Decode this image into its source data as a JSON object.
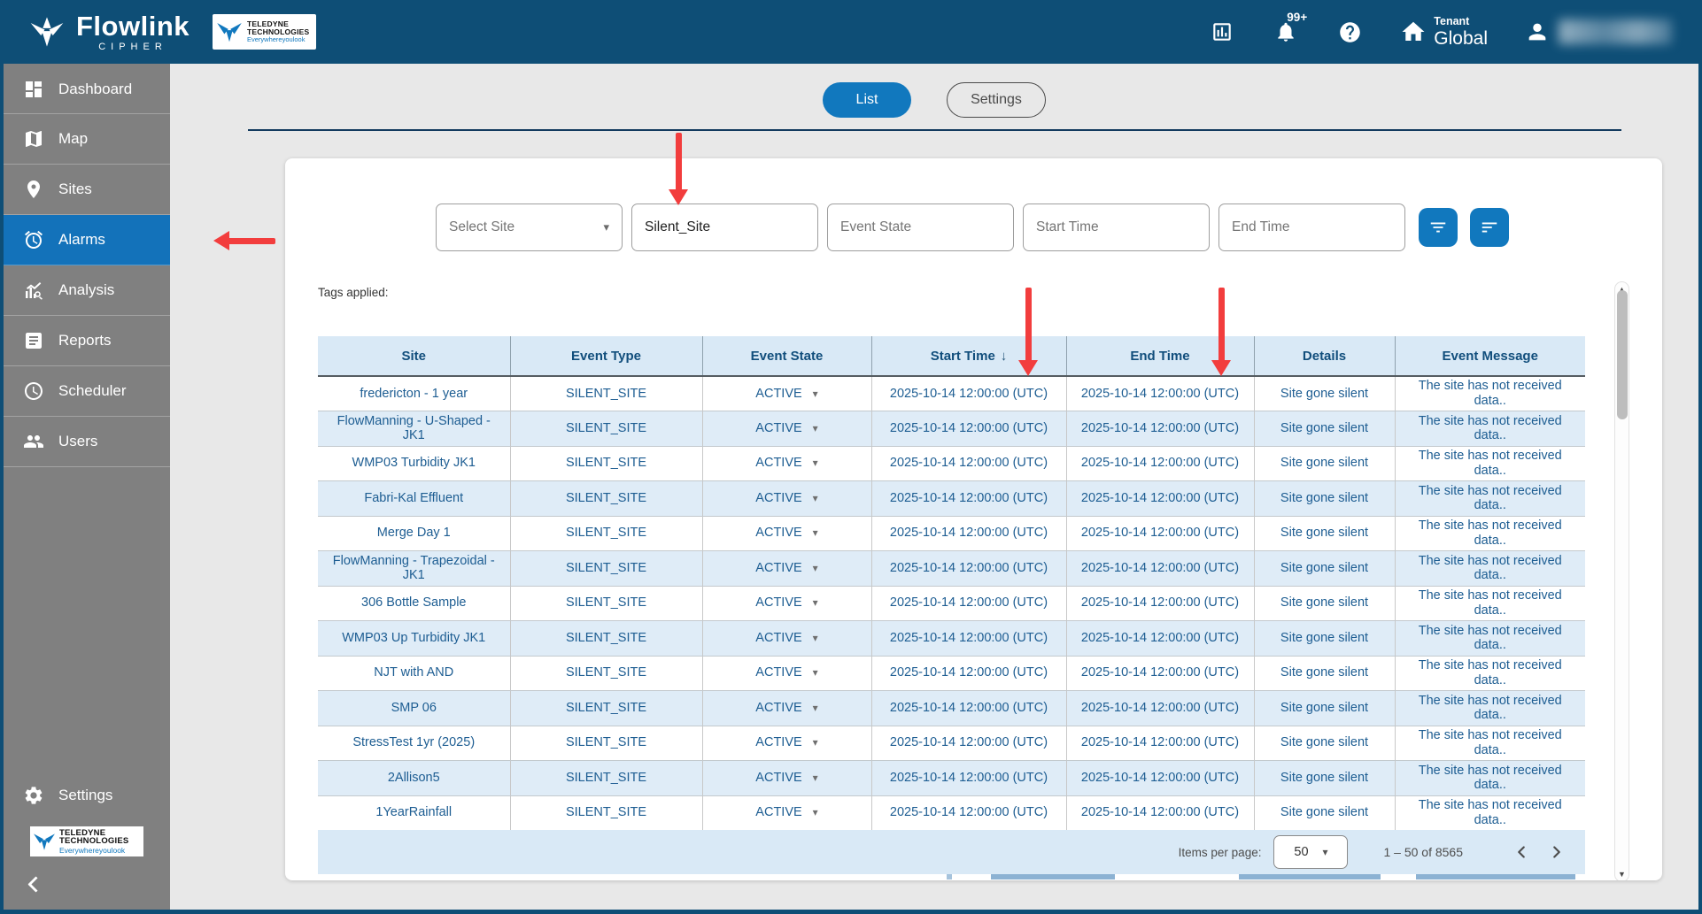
{
  "navbar": {
    "brand_name": "Flowlink",
    "brand_sub": "CIPHER",
    "teledyne": {
      "line1": "TELEDYNE",
      "line2": "TECHNOLOGIES",
      "tagline": "Everywhereyoulook"
    },
    "notification_badge": "99+",
    "tenant_label": "Tenant",
    "tenant_name": "Global"
  },
  "sidebar": {
    "items": [
      {
        "label": "Dashboard",
        "icon": "dashboard-icon",
        "active": false
      },
      {
        "label": "Map",
        "icon": "map-icon",
        "active": false
      },
      {
        "label": "Sites",
        "icon": "location-pin-icon",
        "active": false
      },
      {
        "label": "Alarms",
        "icon": "alarm-clock-icon",
        "active": true
      },
      {
        "label": "Analysis",
        "icon": "analysis-chart-icon",
        "active": false
      },
      {
        "label": "Reports",
        "icon": "report-document-icon",
        "active": false
      },
      {
        "label": "Scheduler",
        "icon": "clock-icon",
        "active": false
      },
      {
        "label": "Users",
        "icon": "people-icon",
        "active": false
      }
    ],
    "settings_label": "Settings",
    "teledyne": {
      "line1": "TELEDYNE",
      "line2": "TECHNOLOGIES",
      "tagline": "Everywhereyoulook"
    }
  },
  "view_toggle": {
    "list_label": "List",
    "settings_label": "Settings"
  },
  "filters": {
    "select_site_placeholder": "Select Site",
    "site_value": "Silent_Site",
    "event_state_placeholder": "Event State",
    "start_time_placeholder": "Start Time",
    "end_time_placeholder": "End Time"
  },
  "tags_applied_label": "Tags applied:",
  "table": {
    "columns": [
      "Site",
      "Event Type",
      "Event State",
      "Start Time",
      "End Time",
      "Details",
      "Event Message"
    ],
    "sort_column": "Start Time",
    "sort_indicator": "↓",
    "rows": [
      {
        "site": "fredericton - 1 year",
        "event_type": "SILENT_SITE",
        "event_state": "ACTIVE",
        "start_time": "2025-10-14 12:00:00 (UTC)",
        "end_time": "2025-10-14 12:00:00 (UTC)",
        "details": "Site gone silent",
        "message": "The site has not received data.."
      },
      {
        "site": "FlowManning - U-Shaped - JK1",
        "event_type": "SILENT_SITE",
        "event_state": "ACTIVE",
        "start_time": "2025-10-14 12:00:00 (UTC)",
        "end_time": "2025-10-14 12:00:00 (UTC)",
        "details": "Site gone silent",
        "message": "The site has not received data.."
      },
      {
        "site": "WMP03 Turbidity JK1",
        "event_type": "SILENT_SITE",
        "event_state": "ACTIVE",
        "start_time": "2025-10-14 12:00:00 (UTC)",
        "end_time": "2025-10-14 12:00:00 (UTC)",
        "details": "Site gone silent",
        "message": "The site has not received data.."
      },
      {
        "site": "Fabri-Kal Effluent",
        "event_type": "SILENT_SITE",
        "event_state": "ACTIVE",
        "start_time": "2025-10-14 12:00:00 (UTC)",
        "end_time": "2025-10-14 12:00:00 (UTC)",
        "details": "Site gone silent",
        "message": "The site has not received data.."
      },
      {
        "site": "Merge Day 1",
        "event_type": "SILENT_SITE",
        "event_state": "ACTIVE",
        "start_time": "2025-10-14 12:00:00 (UTC)",
        "end_time": "2025-10-14 12:00:00 (UTC)",
        "details": "Site gone silent",
        "message": "The site has not received data.."
      },
      {
        "site": "FlowManning - Trapezoidal - JK1",
        "event_type": "SILENT_SITE",
        "event_state": "ACTIVE",
        "start_time": "2025-10-14 12:00:00 (UTC)",
        "end_time": "2025-10-14 12:00:00 (UTC)",
        "details": "Site gone silent",
        "message": "The site has not received data.."
      },
      {
        "site": "306 Bottle Sample",
        "event_type": "SILENT_SITE",
        "event_state": "ACTIVE",
        "start_time": "2025-10-14 12:00:00 (UTC)",
        "end_time": "2025-10-14 12:00:00 (UTC)",
        "details": "Site gone silent",
        "message": "The site has not received data.."
      },
      {
        "site": "WMP03 Up Turbidity JK1",
        "event_type": "SILENT_SITE",
        "event_state": "ACTIVE",
        "start_time": "2025-10-14 12:00:00 (UTC)",
        "end_time": "2025-10-14 12:00:00 (UTC)",
        "details": "Site gone silent",
        "message": "The site has not received data.."
      },
      {
        "site": "NJT with AND",
        "event_type": "SILENT_SITE",
        "event_state": "ACTIVE",
        "start_time": "2025-10-14 12:00:00 (UTC)",
        "end_time": "2025-10-14 12:00:00 (UTC)",
        "details": "Site gone silent",
        "message": "The site has not received data.."
      },
      {
        "site": "SMP 06",
        "event_type": "SILENT_SITE",
        "event_state": "ACTIVE",
        "start_time": "2025-10-14 12:00:00 (UTC)",
        "end_time": "2025-10-14 12:00:00 (UTC)",
        "details": "Site gone silent",
        "message": "The site has not received data.."
      },
      {
        "site": "StressTest 1yr (2025)",
        "event_type": "SILENT_SITE",
        "event_state": "ACTIVE",
        "start_time": "2025-10-14 12:00:00 (UTC)",
        "end_time": "2025-10-14 12:00:00 (UTC)",
        "details": "Site gone silent",
        "message": "The site has not received data.."
      },
      {
        "site": "2Allison5",
        "event_type": "SILENT_SITE",
        "event_state": "ACTIVE",
        "start_time": "2025-10-14 12:00:00 (UTC)",
        "end_time": "2025-10-14 12:00:00 (UTC)",
        "details": "Site gone silent",
        "message": "The site has not received data.."
      },
      {
        "site": "1YearRainfall",
        "event_type": "SILENT_SITE",
        "event_state": "ACTIVE",
        "start_time": "2025-10-14 12:00:00 (UTC)",
        "end_time": "2025-10-14 12:00:00 (UTC)",
        "details": "Site gone silent",
        "message": "The site has not received data.."
      }
    ]
  },
  "pagination": {
    "items_per_page_label": "Items per page:",
    "items_per_page": "50",
    "range": "1 – 50 of 8565"
  },
  "colors": {
    "navy": "#0e4e76",
    "accent_blue": "#1178be",
    "sidebar_gray": "#808080",
    "selected_blue": "#1372ba",
    "table_header_bg": "#d9e9f6",
    "row_alt_bg": "#dfecf7",
    "cell_text": "#1d5d92",
    "annotation_red": "#f23d3d"
  }
}
